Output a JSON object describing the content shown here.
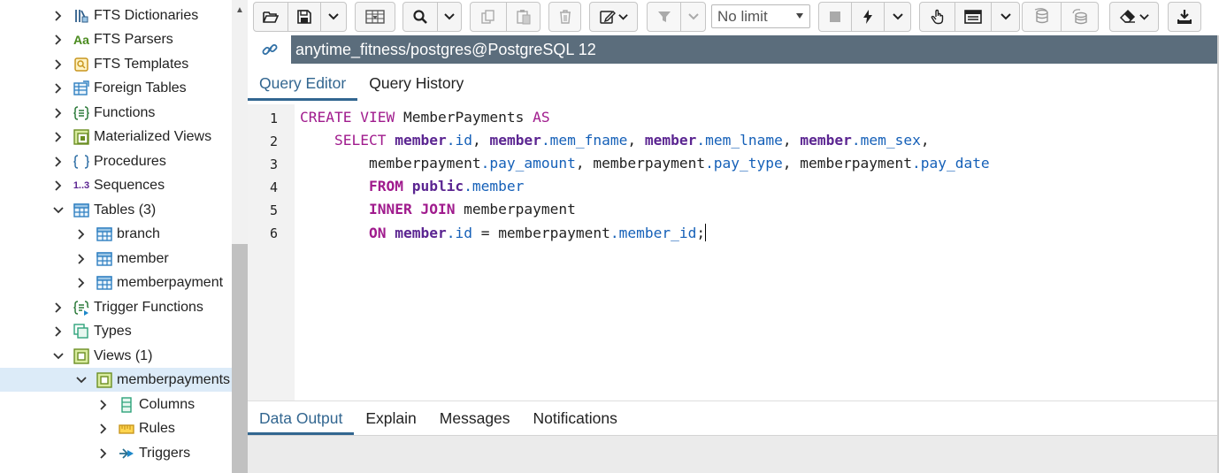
{
  "tree": {
    "items": [
      {
        "label": "FTS Dictionaries",
        "icon": "fts-dictionary-icon",
        "expanded": false
      },
      {
        "label": "FTS Parsers",
        "icon": "fts-parser-icon",
        "expanded": false
      },
      {
        "label": "FTS Templates",
        "icon": "fts-template-icon",
        "expanded": false
      },
      {
        "label": "Foreign Tables",
        "icon": "foreign-table-icon",
        "expanded": false
      },
      {
        "label": "Functions",
        "icon": "function-icon",
        "expanded": false
      },
      {
        "label": "Materialized Views",
        "icon": "materialized-view-icon",
        "expanded": false
      },
      {
        "label": "Procedures",
        "icon": "procedure-icon",
        "expanded": false
      },
      {
        "label": "Sequences",
        "icon": "sequence-icon",
        "expanded": false
      },
      {
        "label": "Tables (3)",
        "icon": "tables-icon",
        "expanded": true
      },
      {
        "label": "branch",
        "icon": "table-icon",
        "expanded": false
      },
      {
        "label": "member",
        "icon": "table-icon",
        "expanded": false
      },
      {
        "label": "memberpayment",
        "icon": "table-icon",
        "expanded": false
      },
      {
        "label": "Trigger Functions",
        "icon": "trigger-function-icon",
        "expanded": false
      },
      {
        "label": "Types",
        "icon": "types-icon",
        "expanded": false
      },
      {
        "label": "Views (1)",
        "icon": "views-icon",
        "expanded": true
      },
      {
        "label": "memberpayments",
        "icon": "view-icon",
        "expanded": true,
        "selected": true
      },
      {
        "label": "Columns",
        "icon": "columns-icon",
        "expanded": false
      },
      {
        "label": "Rules",
        "icon": "rules-icon",
        "expanded": false
      },
      {
        "label": "Triggers",
        "icon": "triggers-icon",
        "expanded": false
      }
    ],
    "sequence_icon_text": "1..3",
    "fts_parser_icon_text": "Aa"
  },
  "toolbar": {
    "limit_value": "No limit",
    "buttons": [
      "open-file",
      "save-file",
      "save-options",
      "edit-grid",
      "find",
      "find-options",
      "copy",
      "paste",
      "delete",
      "edit-options",
      "filter",
      "filter-options",
      "limit",
      "stop",
      "execute",
      "execute-options",
      "edit-mode",
      "explain",
      "explain-options",
      "commit",
      "rollback",
      "clear-options",
      "download"
    ]
  },
  "connection": {
    "title": "anytime_fitness/postgres@PostgreSQL 12"
  },
  "editor_tabs": [
    "Query Editor",
    "Query History"
  ],
  "editor": {
    "line_numbers": [
      "1",
      "2",
      "3",
      "4",
      "5",
      "6"
    ]
  },
  "output_tabs": [
    "Data Output",
    "Explain",
    "Messages",
    "Notifications"
  ],
  "colors": {
    "accent": "#326690",
    "connection_bar": "#5b6d7c",
    "keyword": "#a01b8d",
    "field": "#1560b8",
    "selected_row": "#dcebf8"
  }
}
